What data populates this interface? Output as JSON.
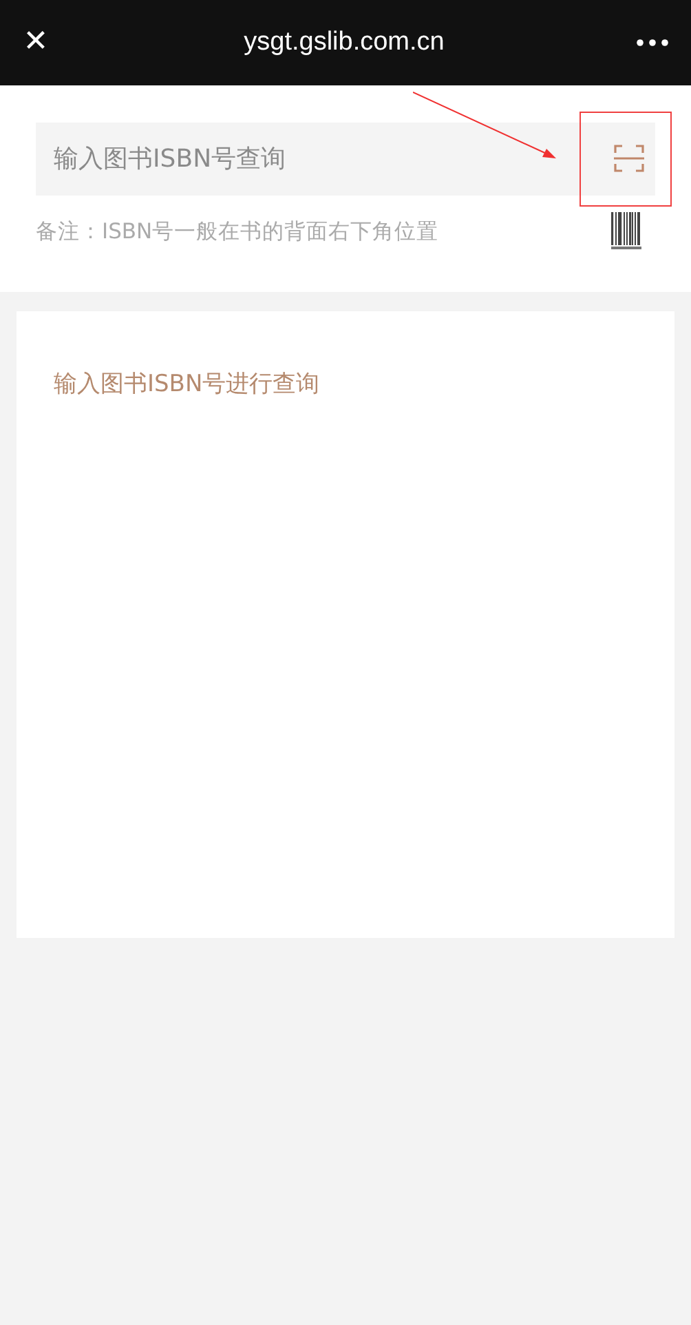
{
  "header": {
    "close": "✕",
    "title": "ysgt.gslib.com.cn"
  },
  "search": {
    "placeholder": "输入图书ISBN号查询"
  },
  "note": "备注：ISBN号一般在书的背面右下角位置",
  "result": {
    "message": "输入图书ISBN号进行查询"
  }
}
